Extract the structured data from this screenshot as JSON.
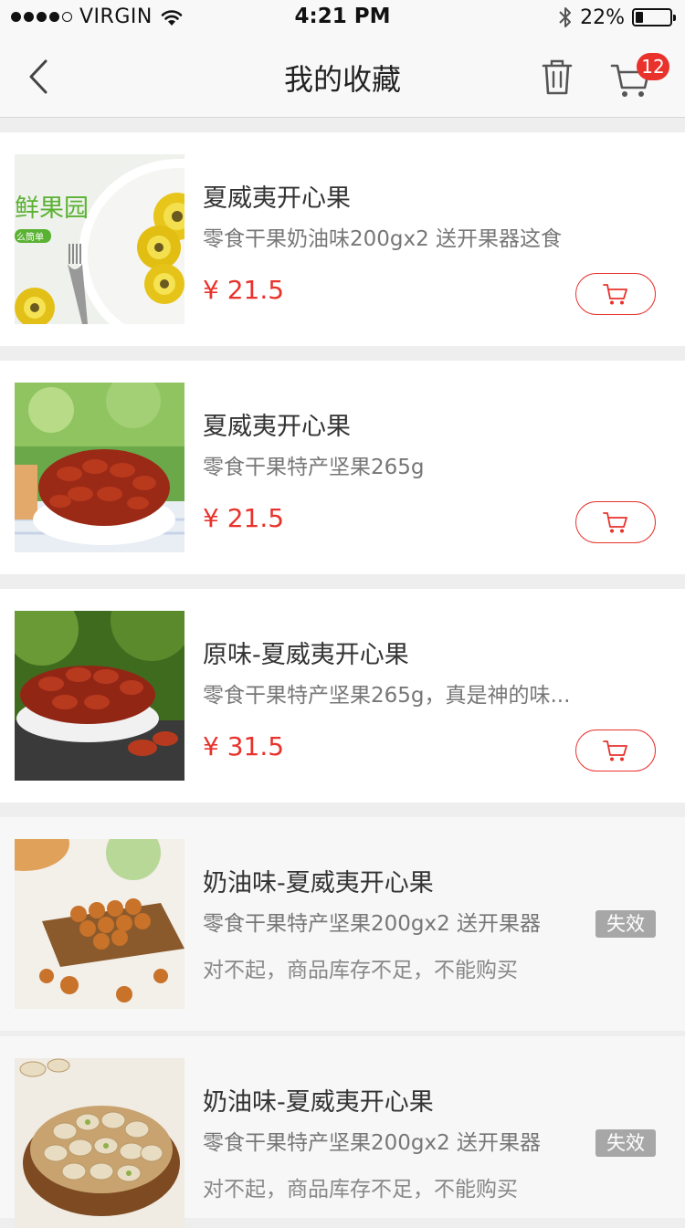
{
  "status_bar": {
    "carrier": "VIRGIN",
    "time": "4:21 PM",
    "battery": "22%",
    "battery_level": 0.22
  },
  "nav": {
    "title": "我的收藏",
    "cart_count": "12"
  },
  "items": [
    {
      "name": "夏威夷开心果",
      "desc": "零食干果奶油味200gx2 送开果器这食",
      "price": "¥ 21.5",
      "image_text": "鲜果园",
      "image_subtext": "么筒单"
    },
    {
      "name": "夏威夷开心果",
      "desc": "零食干果特产坚果265g",
      "price": "¥ 21.5"
    },
    {
      "name": "原味-夏威夷开心果",
      "desc": "零食干果特产坚果265g，真是神的味...",
      "price": "¥ 31.5"
    },
    {
      "name": "奶油味-夏威夷开心果",
      "desc": "零食干果特产坚果200gx2 送开果器",
      "status": "失效",
      "note": "对不起，商品库存不足，不能购买"
    },
    {
      "name": "奶油味-夏威夷开心果",
      "desc": "零食干果特产坚果200gx2 送开果器",
      "status": "失效",
      "note": "对不起，商品库存不足，不能购买"
    }
  ],
  "colors": {
    "accent": "#e8322b",
    "tag_gray": "#a7a7a7",
    "background": "#eeeeee"
  },
  "icons": [
    "signal-dots-icon",
    "wifi-icon",
    "bluetooth-icon",
    "battery-icon",
    "back-chevron-icon",
    "trash-icon",
    "cart-icon"
  ]
}
